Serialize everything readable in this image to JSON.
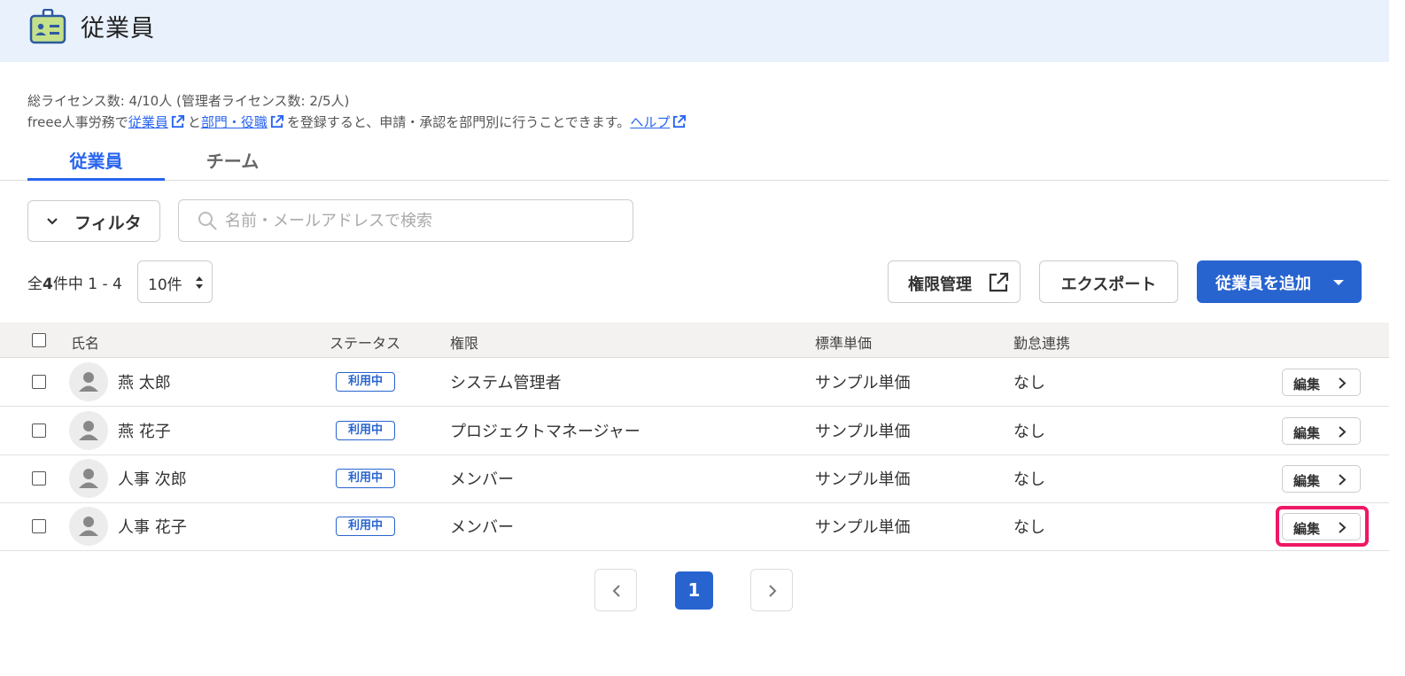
{
  "header": {
    "title": "従業員",
    "icon": "employee-badge-icon"
  },
  "info": {
    "license": "総ライセンス数: 4/10人 (管理者ライセンス数: 2/5人)",
    "help_prefix": "freee人事労務で",
    "link_employees": "従業員",
    "conj": "と",
    "link_departments": "部門・役職",
    "help_middle": "を登録すると、申請・承認を部門別に行うことできます。",
    "link_help": "ヘルプ"
  },
  "tabs": [
    {
      "label": "従業員",
      "active": true
    },
    {
      "label": "チーム",
      "active": false
    }
  ],
  "filter": {
    "label": "フィルタ"
  },
  "search": {
    "placeholder": "名前・メールアドレスで検索",
    "value": ""
  },
  "pagination_info": {
    "prefix": "全",
    "total": "4",
    "suffix": "件中 1 - 4",
    "per_page": "10件"
  },
  "actions": {
    "permissions": "権限管理",
    "export": "エクスポート",
    "add": "従業員を追加"
  },
  "table": {
    "headers": {
      "name": "氏名",
      "status": "ステータス",
      "role": "権限",
      "price": "標準単価",
      "sync": "勤怠連携"
    },
    "rows": [
      {
        "name": "燕 太郎",
        "status": "利用中",
        "role": "システム管理者",
        "price": "サンプル単価",
        "sync": "なし",
        "edit": "編集"
      },
      {
        "name": "燕 花子",
        "status": "利用中",
        "role": "プロジェクトマネージャー",
        "price": "サンプル単価",
        "sync": "なし",
        "edit": "編集"
      },
      {
        "name": "人事 次郎",
        "status": "利用中",
        "role": "メンバー",
        "price": "サンプル単価",
        "sync": "なし",
        "edit": "編集"
      },
      {
        "name": "人事 花子",
        "status": "利用中",
        "role": "メンバー",
        "price": "サンプル単価",
        "sync": "なし",
        "edit": "編集"
      }
    ]
  },
  "pager": {
    "current": "1"
  },
  "colors": {
    "accent": "#2864d0",
    "header_bg": "#e9f1fd",
    "highlight": "#ee1865"
  }
}
